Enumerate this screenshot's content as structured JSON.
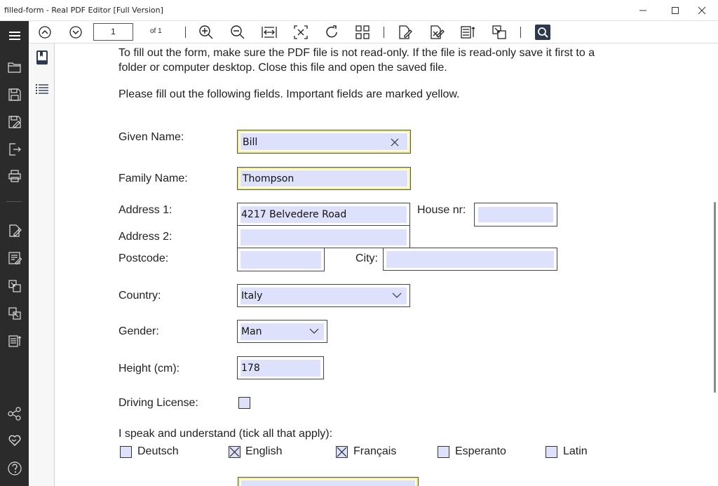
{
  "window": {
    "title": "filled-form - Real PDF Editor [Full Version]"
  },
  "toolbar": {
    "page_current": "1",
    "page_of": "of 1"
  },
  "instructions": {
    "line1": "To fill out the form, make sure the PDF file is not read-only. If the file is read-only save it first to a",
    "line2": "folder or computer desktop. Close this file and open the saved file.",
    "line3": "Please fill out the following fields. Important fields are marked yellow."
  },
  "form": {
    "given_name": {
      "label": "Given Name:",
      "value": "Bill"
    },
    "family_name": {
      "label": "Family Name:",
      "value": "Thompson"
    },
    "address1": {
      "label": "Address 1:",
      "value": "4217 Belvedere Road"
    },
    "house_nr": {
      "label": "House nr:",
      "value": ""
    },
    "address2": {
      "label": "Address 2:",
      "value": ""
    },
    "postcode": {
      "label": "Postcode:",
      "value": ""
    },
    "city": {
      "label": "City:",
      "value": ""
    },
    "country": {
      "label": "Country:",
      "value": "Italy"
    },
    "gender": {
      "label": "Gender:",
      "value": "Man"
    },
    "height": {
      "label": "Height (cm):",
      "value": "178"
    },
    "driving_license": {
      "label": "Driving License:",
      "checked": false
    },
    "languages": {
      "label": "I speak and understand (tick all that apply):",
      "items": [
        {
          "label": "Deutsch",
          "checked": false
        },
        {
          "label": "English",
          "checked": true
        },
        {
          "label": "Français",
          "checked": true
        },
        {
          "label": "Esperanto",
          "checked": false
        },
        {
          "label": "Latin",
          "checked": false
        }
      ]
    }
  },
  "colors": {
    "appbar": "#2b2b2b",
    "field_fill": "#dde1fb",
    "required_border": "#f3ee7a"
  },
  "icons": {
    "app": [
      "menu-icon",
      "open-folder-icon",
      "save-icon",
      "save-as-icon",
      "export-icon",
      "print-icon",
      "edit-document-icon",
      "fill-form-icon",
      "convert-icon",
      "convert-alt-icon",
      "compress-icon",
      "share-icon",
      "favorite-icon",
      "help-icon"
    ],
    "toolbar": [
      "page-up-icon",
      "page-down-icon",
      "zoom-in-icon",
      "zoom-out-icon",
      "fit-width-icon",
      "fit-page-icon",
      "rotate-icon",
      "thumbnails-icon",
      "edit-icon",
      "sign-icon",
      "reflow-icon",
      "convert-icon",
      "search-icon"
    ]
  }
}
